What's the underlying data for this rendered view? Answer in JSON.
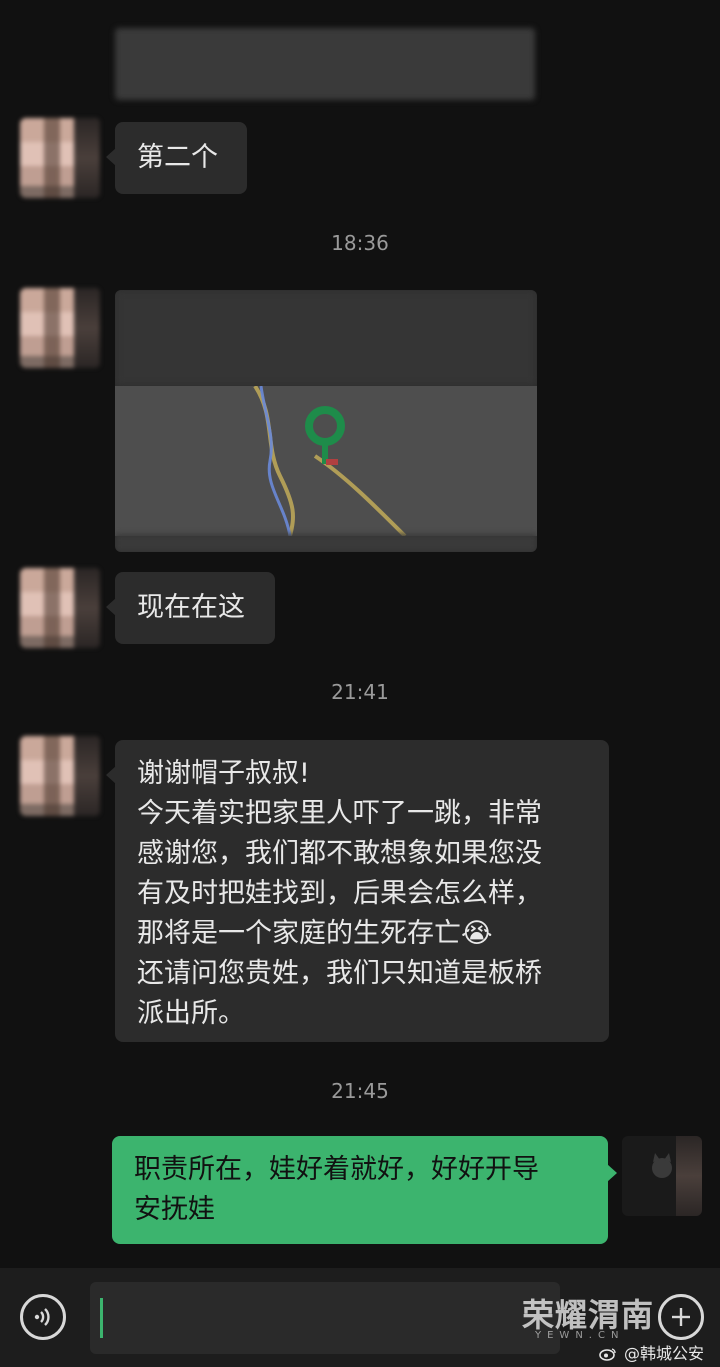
{
  "messages": {
    "second_one": "第二个",
    "here_now": "现在在这",
    "thanks_lines": [
      "谢谢帽子叔叔!",
      "今天着实把家里人吓了一跳，非常",
      "感谢您，我们都不敢想象如果您没",
      "有及时把娃找到，后果会怎么样，",
      "那将是一个家庭的生死存亡",
      "还请问您贵姓，我们只知道是板桥",
      "派出所。"
    ],
    "crying_emoji": "😭",
    "reply_lines": [
      "职责所在，娃好着就好，好好开导",
      "安抚娃"
    ]
  },
  "timestamps": [
    "18:36",
    "21:41",
    "21:45"
  ],
  "bottom_bar": {
    "watermark": "荣耀渭南",
    "watermark_sub": "YEWN.CN",
    "credit_prefix": "@",
    "credit": "韩城公安"
  },
  "colors": {
    "background": "#111111",
    "incoming_bubble": "#2c2c2c",
    "outgoing_bubble": "#3cb46e",
    "map_pin": "#1e8c4a"
  },
  "icons": {
    "voice": "voice-icon",
    "add": "plus-icon",
    "map_pin": "map-pin-icon",
    "weibo": "weibo-icon"
  }
}
